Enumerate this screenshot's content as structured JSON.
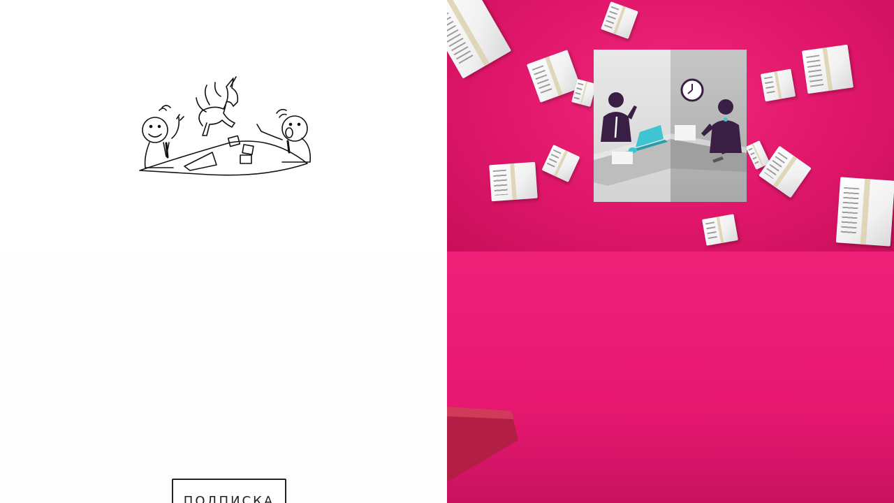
{
  "top_left": {
    "illustration": "sketch-meeting-with-unicorn"
  },
  "top_right": {
    "background_color": "#e0166a",
    "illustration": "office-workers-panel-with-boxes"
  },
  "bottom_left": {
    "stamp_label": "ПОДПИСКА"
  },
  "bottom_right": {
    "background_color": "#e81870"
  }
}
